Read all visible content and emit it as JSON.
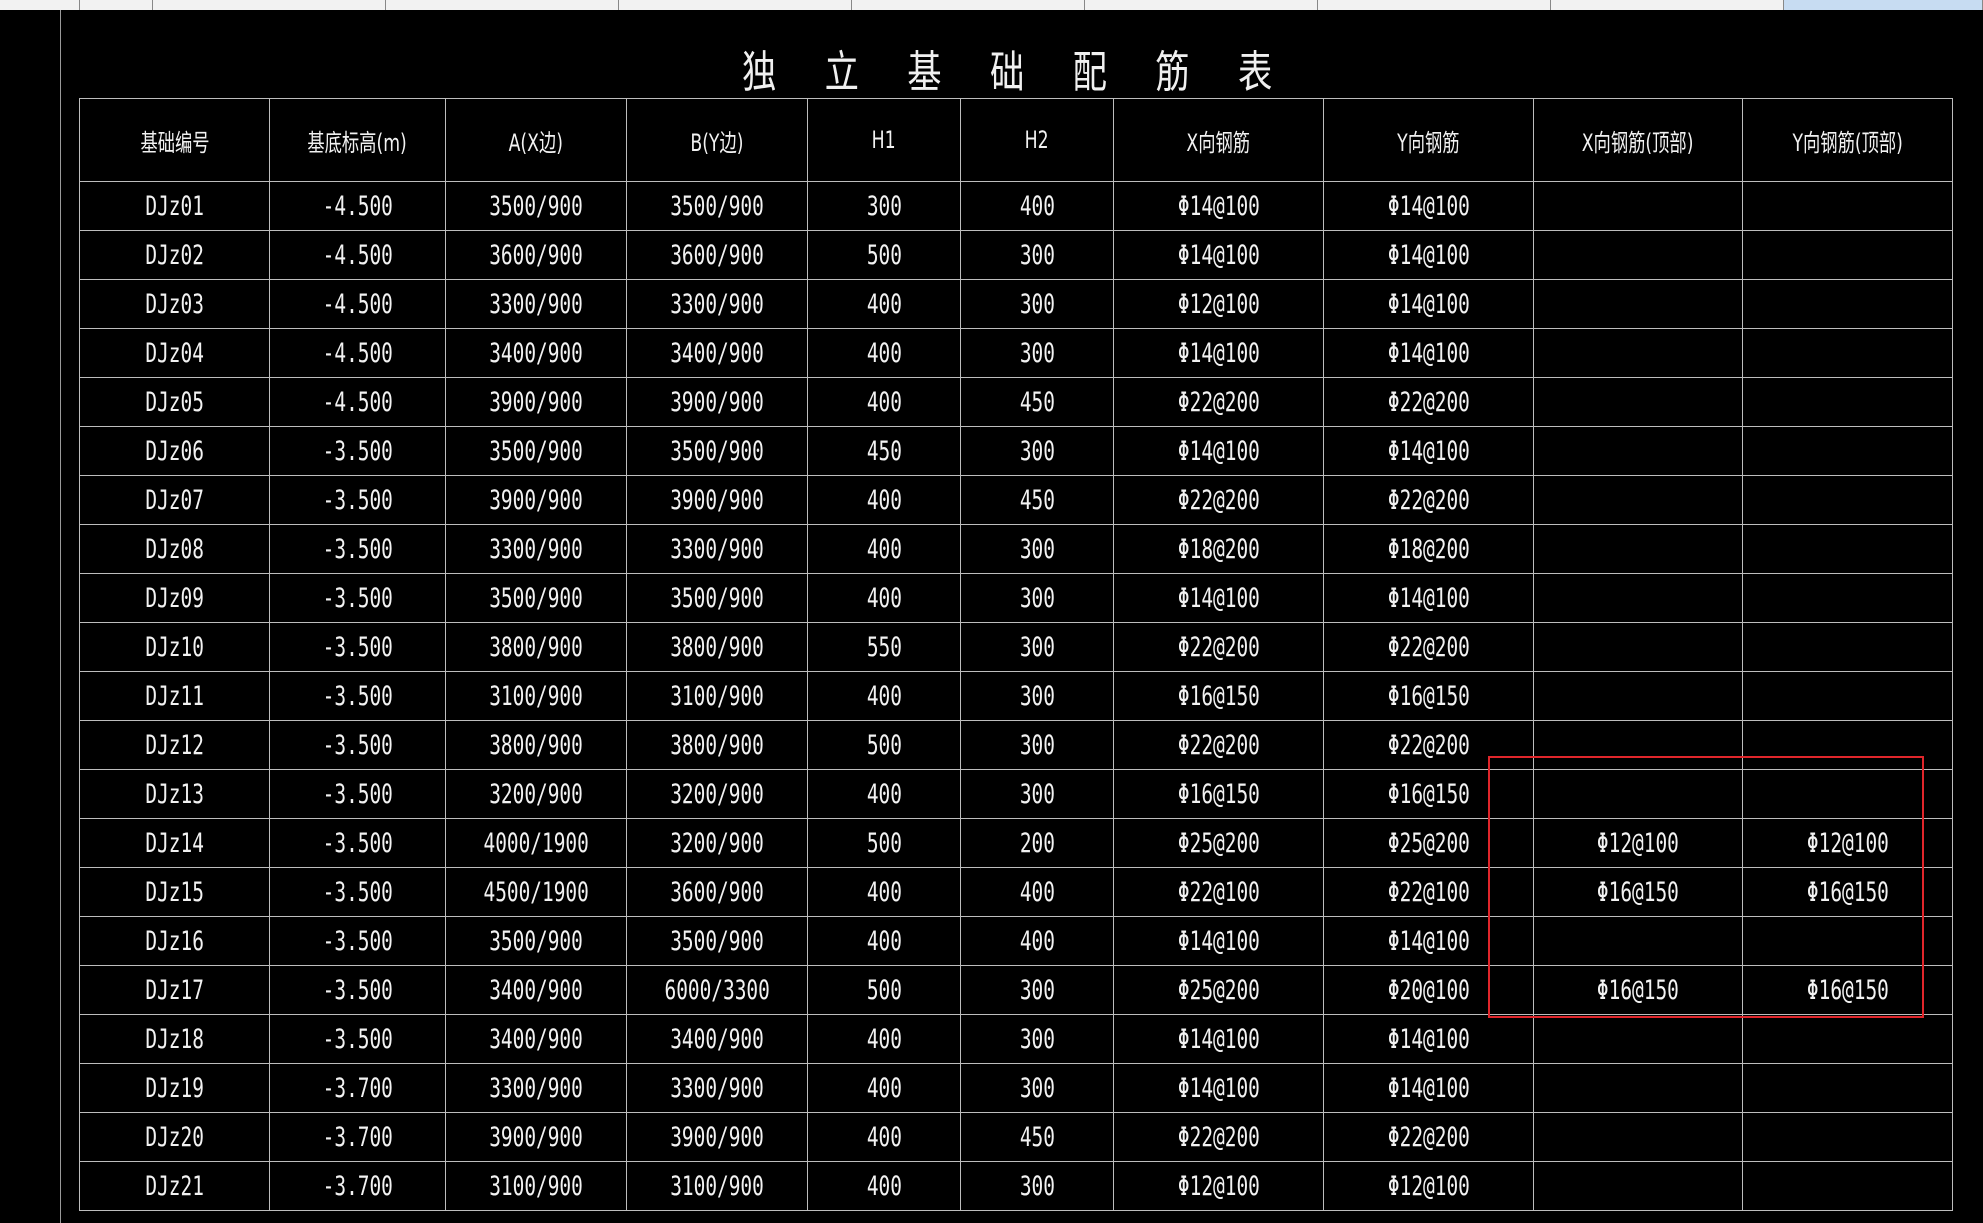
{
  "title": "独 立 基 础 配 筋 表",
  "columns": [
    "基础编号",
    "基底标高(m)",
    "A(X边)",
    "B(Y边)",
    "H1",
    "H2",
    "X向钢筋",
    "Y向钢筋",
    "X向钢筋(顶部)",
    "Y向钢筋(顶部)"
  ],
  "rows": [
    [
      "DJz01",
      "-4.500",
      "3500/900",
      "3500/900",
      "300",
      "400",
      "Φ14@100",
      "Φ14@100",
      "",
      ""
    ],
    [
      "DJz02",
      "-4.500",
      "3600/900",
      "3600/900",
      "500",
      "300",
      "Φ14@100",
      "Φ14@100",
      "",
      ""
    ],
    [
      "DJz03",
      "-4.500",
      "3300/900",
      "3300/900",
      "400",
      "300",
      "Φ12@100",
      "Φ14@100",
      "",
      ""
    ],
    [
      "DJz04",
      "-4.500",
      "3400/900",
      "3400/900",
      "400",
      "300",
      "Φ14@100",
      "Φ14@100",
      "",
      ""
    ],
    [
      "DJz05",
      "-4.500",
      "3900/900",
      "3900/900",
      "400",
      "450",
      "Φ22@200",
      "Φ22@200",
      "",
      ""
    ],
    [
      "DJz06",
      "-3.500",
      "3500/900",
      "3500/900",
      "450",
      "300",
      "Φ14@100",
      "Φ14@100",
      "",
      ""
    ],
    [
      "DJz07",
      "-3.500",
      "3900/900",
      "3900/900",
      "400",
      "450",
      "Φ22@200",
      "Φ22@200",
      "",
      ""
    ],
    [
      "DJz08",
      "-3.500",
      "3300/900",
      "3300/900",
      "400",
      "300",
      "Φ18@200",
      "Φ18@200",
      "",
      ""
    ],
    [
      "DJz09",
      "-3.500",
      "3500/900",
      "3500/900",
      "400",
      "300",
      "Φ14@100",
      "Φ14@100",
      "",
      ""
    ],
    [
      "DJz10",
      "-3.500",
      "3800/900",
      "3800/900",
      "550",
      "300",
      "Φ22@200",
      "Φ22@200",
      "",
      ""
    ],
    [
      "DJz11",
      "-3.500",
      "3100/900",
      "3100/900",
      "400",
      "300",
      "Φ16@150",
      "Φ16@150",
      "",
      ""
    ],
    [
      "DJz12",
      "-3.500",
      "3800/900",
      "3800/900",
      "500",
      "300",
      "Φ22@200",
      "Φ22@200",
      "",
      ""
    ],
    [
      "DJz13",
      "-3.500",
      "3200/900",
      "3200/900",
      "400",
      "300",
      "Φ16@150",
      "Φ16@150",
      "",
      ""
    ],
    [
      "DJz14",
      "-3.500",
      "4000/1900",
      "3200/900",
      "500",
      "200",
      "Φ25@200",
      "Φ25@200",
      "Φ12@100",
      "Φ12@100"
    ],
    [
      "DJz15",
      "-3.500",
      "4500/1900",
      "3600/900",
      "400",
      "400",
      "Φ22@100",
      "Φ22@100",
      "Φ16@150",
      "Φ16@150"
    ],
    [
      "DJz16",
      "-3.500",
      "3500/900",
      "3500/900",
      "400",
      "400",
      "Φ14@100",
      "Φ14@100",
      "",
      ""
    ],
    [
      "DJz17",
      "-3.500",
      "3400/900",
      "6000/3300",
      "500",
      "300",
      "Φ25@200",
      "Φ20@100",
      "Φ16@150",
      "Φ16@150"
    ],
    [
      "DJz18",
      "-3.500",
      "3400/900",
      "3400/900",
      "400",
      "300",
      "Φ14@100",
      "Φ14@100",
      "",
      ""
    ],
    [
      "DJz19",
      "-3.700",
      "3300/900",
      "3300/900",
      "400",
      "300",
      "Φ14@100",
      "Φ14@100",
      "",
      ""
    ],
    [
      "DJz20",
      "-3.700",
      "3900/900",
      "3900/900",
      "400",
      "450",
      "Φ22@200",
      "Φ22@200",
      "",
      ""
    ],
    [
      "DJz21",
      "-3.700",
      "3100/900",
      "3100/900",
      "400",
      "300",
      "Φ12@100",
      "Φ12@100",
      "",
      ""
    ]
  ],
  "colors": {
    "background": "#000000",
    "line": "#bdbdbd",
    "text": "#f2f2f2",
    "highlight": "#e0262b"
  }
}
